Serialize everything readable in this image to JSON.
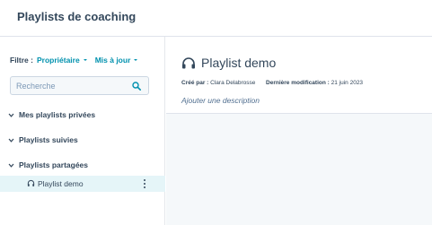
{
  "header": {
    "title": "Playlists de coaching"
  },
  "filters": {
    "label": "Filtre :",
    "owner": "Propriétaire",
    "updated": "Mis à jour"
  },
  "search": {
    "placeholder": "Recherche"
  },
  "sections": {
    "private": "Mes playlists privées",
    "followed": "Playlists suivies",
    "shared": "Playlists partagées"
  },
  "shared_items": [
    {
      "label": "Playlist demo"
    }
  ],
  "playlist": {
    "title": "Playlist demo",
    "created_by_label": "Créé par :",
    "created_by": "Clara Delabrosse",
    "modified_label": "Dernière modification :",
    "modified": "21 juin 2023",
    "description_placeholder": "Ajouter une description"
  },
  "colors": {
    "accent": "#0091ae",
    "text": "#33475b",
    "selected_bg": "#e5f5f8"
  }
}
